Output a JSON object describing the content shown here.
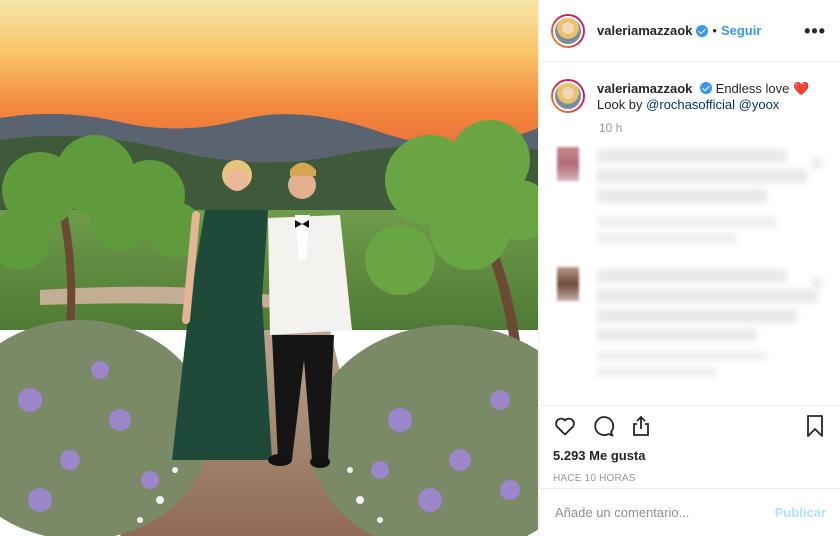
{
  "post": {
    "username": "valeriamazzaok",
    "follow_label": "Seguir",
    "separator": "•",
    "more_label": "•••"
  },
  "caption": {
    "username": "valeriamazzaok",
    "text": "Endless love",
    "emoji": "❤️",
    "look_by": "Look by",
    "mention_1": "@rochasofficial",
    "mention_2": "@yoox",
    "time": "10 h"
  },
  "actions": {
    "icons": [
      "heart-icon",
      "comment-icon",
      "share-icon",
      "bookmark-icon"
    ],
    "likes": "5.293 Me gusta",
    "timestamp": "HACE 10 HORAS"
  },
  "comment_box": {
    "placeholder": "Añade un comentario...",
    "publish_label": "Publicar"
  },
  "colors": {
    "accent": "#3897f0",
    "publish_disabled": "#b2dffc",
    "text": "#262626",
    "muted": "#999999"
  }
}
